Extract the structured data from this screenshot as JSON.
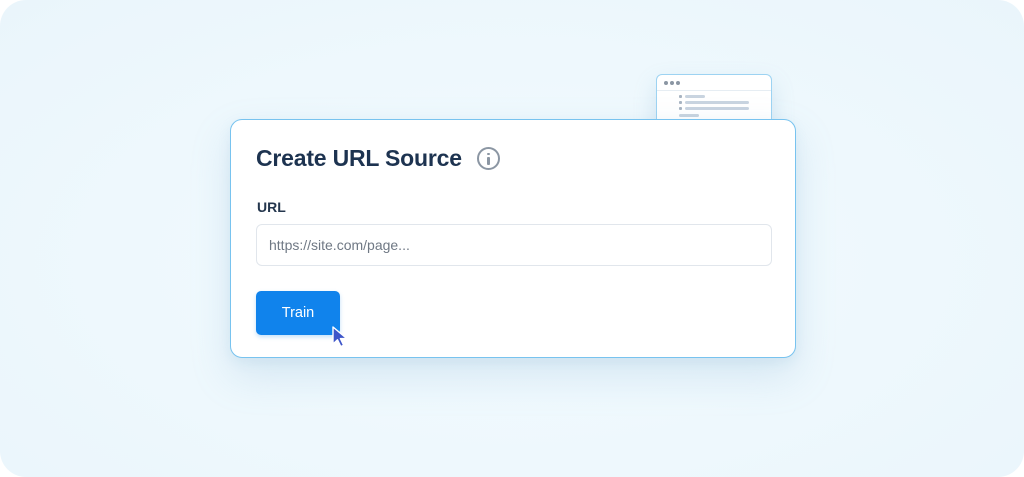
{
  "form": {
    "title": "Create URL Source",
    "url_label": "URL",
    "url_placeholder": "https://site.com/page...",
    "url_value": "",
    "train_label": "Train"
  },
  "icons": {
    "info": "info-icon",
    "cursor": "mouse-pointer-icon"
  },
  "colors": {
    "accent": "#1083ec",
    "card_border": "#78c3ef",
    "title_text": "#1d3350",
    "background": "#eef8fd"
  }
}
